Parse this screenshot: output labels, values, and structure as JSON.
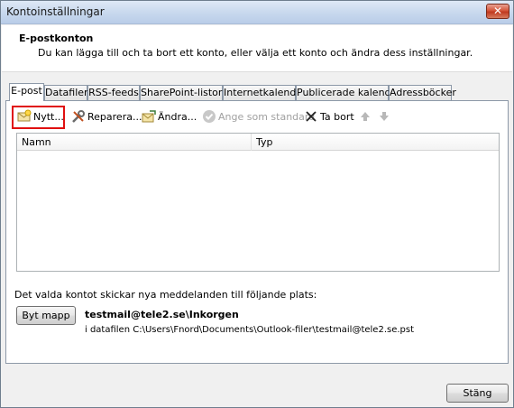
{
  "window": {
    "title": "Kontoinställningar",
    "close_symbol": "✕"
  },
  "header": {
    "title": "E-postkonton",
    "description": "Du kan lägga till och ta bort ett konto, eller välja ett konto och ändra dess inställningar."
  },
  "tabs": [
    {
      "label": "E-post",
      "active": true
    },
    {
      "label": "Datafiler",
      "active": false
    },
    {
      "label": "RSS-feeds",
      "active": false
    },
    {
      "label": "SharePoint-listor",
      "active": false
    },
    {
      "label": "Internetkalendrar",
      "active": false
    },
    {
      "label": "Publicerade kalendrar",
      "active": false
    },
    {
      "label": "Adressböcker",
      "active": false
    }
  ],
  "toolbar": {
    "new_label": "Nytt...",
    "repair_label": "Reparera...",
    "change_label": "Ändra...",
    "set_default_label": "Ange som standard",
    "remove_label": "Ta bort",
    "icons": {
      "new": "new-account-icon",
      "repair": "repair-icon",
      "change": "change-icon",
      "set_default": "checkmark-icon",
      "remove": "remove-x-icon",
      "up": "arrow-up-icon",
      "down": "arrow-down-icon"
    }
  },
  "account_list": {
    "columns": [
      "Namn",
      "Typ"
    ],
    "rows": []
  },
  "delivery": {
    "label": "Det valda kontot skickar nya meddelanden till följande plats:",
    "change_folder_label": "Byt mapp",
    "account_folder": "testmail@tele2.se\\Inkorgen",
    "datafile": "i datafilen C:\\Users\\Fnord\\Documents\\Outlook-filer\\testmail@tele2.se.pst"
  },
  "footer": {
    "close_label": "Stäng"
  },
  "colors": {
    "highlight": "#e01010",
    "titlebar": "#c9d9ee",
    "close_button": "#d4563b"
  }
}
